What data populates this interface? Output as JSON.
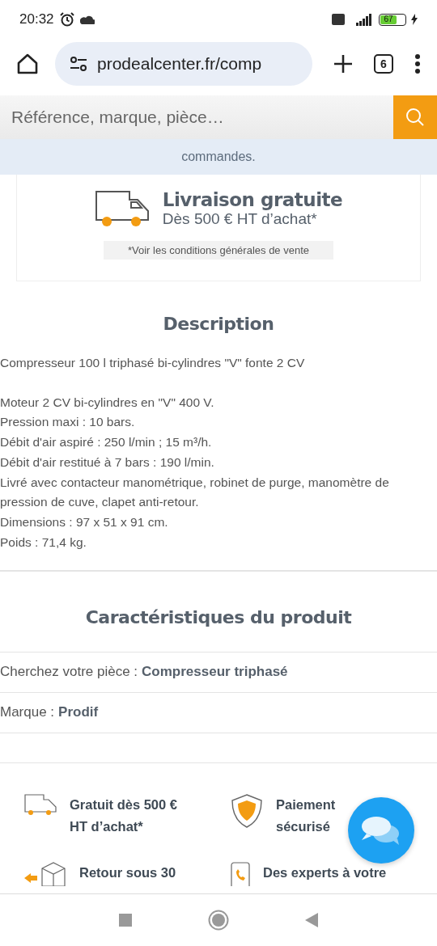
{
  "status_bar": {
    "time": "20:32",
    "battery": "67"
  },
  "browser": {
    "url": "prodealcenter.fr/comp",
    "tab_count": "6"
  },
  "search": {
    "placeholder": "Référence, marque, pièce…"
  },
  "notice": {
    "text": "commandes."
  },
  "delivery": {
    "title": "Livraison gratuite",
    "subtitle": "Dès 500 € HT d’achat*",
    "note": "*Voir les conditions générales de vente"
  },
  "description": {
    "heading": "Description",
    "paragraphs": [
      "Compresseur 100 l triphasé bi-cylindres \"V\" fonte 2 CV",
      "Moteur 2 CV bi-cylindres en \"V\" 400 V.\nPression maxi : 10 bars.\nDébit d'air aspiré : 250 l/min ; 15 m³/h.\nDébit d'air restitué à 7 bars : 190 l/min.\nLivré avec contacteur manométrique, robinet de purge, manomètre de pression de cuve, clapet anti-retour.\nDimensions : 97 x 51 x 91 cm.\nPoids : 71,4 kg."
    ]
  },
  "characteristics": {
    "heading": "Caractéristiques du produit",
    "rows": [
      {
        "label": "Cherchez votre pièce :",
        "value": "Compresseur triphasé"
      },
      {
        "label": "Marque :",
        "value": "Prodif"
      }
    ]
  },
  "features": [
    {
      "kind": "truck",
      "text": "Gratuit dès 500 € HT d’achat*"
    },
    {
      "kind": "shield",
      "text": "Paiement sécurisé"
    },
    {
      "kind": "return",
      "text": "Retour sous 30"
    },
    {
      "kind": "phone",
      "text": "Des experts à votre"
    }
  ]
}
